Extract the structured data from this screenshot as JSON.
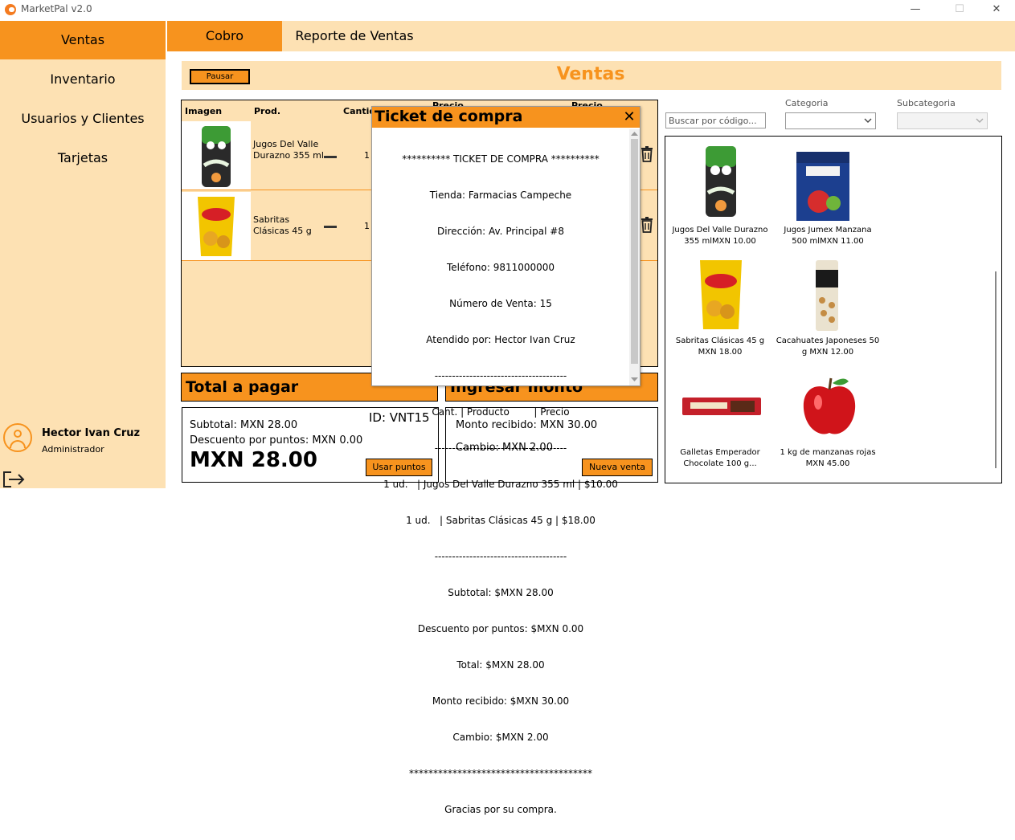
{
  "window": {
    "title": "MarketPal v2.0",
    "minimize_glyph": "—",
    "maximize_glyph": "☐",
    "close_glyph": "✕"
  },
  "sidebar": {
    "items": [
      {
        "label": "Ventas",
        "active": true
      },
      {
        "label": "Inventario",
        "active": false
      },
      {
        "label": "Usuarios y Clientes",
        "active": false
      },
      {
        "label": "Tarjetas",
        "active": false
      }
    ],
    "user": {
      "name": "Hector Ivan Cruz",
      "role": "Administrador"
    }
  },
  "tabs": [
    {
      "label": "Cobro",
      "active": true
    },
    {
      "label": "Reporte de Ventas",
      "active": false
    }
  ],
  "header": {
    "pause_label": "Pausar",
    "title": "Ventas"
  },
  "cart": {
    "columns": [
      "Imagen",
      "Prod.",
      "Cantid",
      "Precio",
      "Precio"
    ],
    "items": [
      {
        "name": "Jugos Del Valle Durazno 355 ml",
        "qty": "1"
      },
      {
        "name": "Sabritas Clásicas 45 g",
        "qty": "1"
      }
    ]
  },
  "totals": {
    "heading": "Total a pagar",
    "id_label": "ID: VNT15",
    "subtotal": "Subtotal: MXN 28.00",
    "discount": "Descuento por puntos: MXN 0.00",
    "total": "MXN 28.00",
    "use_points_label": "Usar puntos"
  },
  "payment": {
    "heading": "Ingresar monto recibido",
    "received": "Monto recibido: MXN 30.00",
    "change": "Cambio: MXN 2.00",
    "new_sale_label": "Nueva venta"
  },
  "catalog": {
    "search_placeholder": "Buscar por código...",
    "category_label": "Categoria",
    "subcategory_label": "Subcategoria",
    "products": [
      {
        "name": "Jugos Del Valle Durazno 355 mlMXN 10.00"
      },
      {
        "name": "Jugos Jumex Manzana 500 mlMXN 11.00"
      },
      {
        "name": "Sabritas Clásicas 45 g MXN 18.00"
      },
      {
        "name": "Cacahuates Japoneses 50 g MXN 12.00"
      },
      {
        "name": "Galletas Emperador Chocolate 100 g..."
      },
      {
        "name": "1 kg de manzanas rojas MXN 45.00"
      }
    ]
  },
  "ticket_modal": {
    "title": "Ticket de compra",
    "close_glyph": "✕",
    "lines": [
      "********** TICKET DE COMPRA **********",
      "Tienda: Farmacias Campeche",
      "Dirección: Av. Principal #8",
      "Teléfono: 9811000000",
      "Número de Venta: 15",
      "Atendido por: Hector Ivan Cruz",
      "--------------------------------------",
      "Cant. | Producto        | Precio",
      "--------------------------------------",
      "1 ud.   | Jugos Del Valle Durazno 355 ml | $10.00",
      "1 ud.   | Sabritas Clásicas 45 g | $18.00",
      "--------------------------------------",
      "Subtotal: $MXN 28.00",
      "Descuento por puntos: $MXN 0.00",
      "Total: $MXN 28.00",
      "Monto recibido: $MXN 30.00",
      "Cambio: $MXN 2.00",
      "**************************************",
      "Gracias por su compra."
    ]
  }
}
